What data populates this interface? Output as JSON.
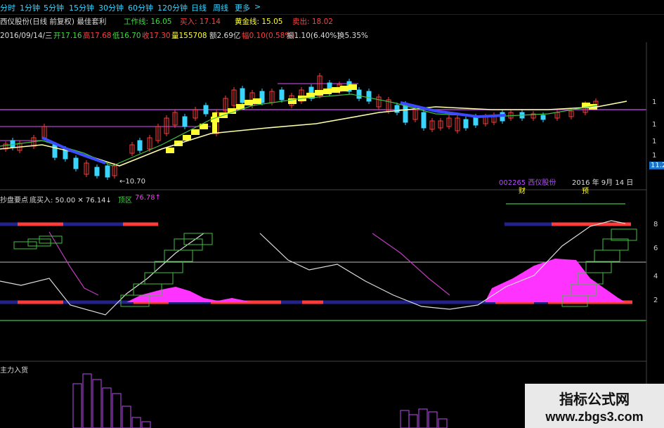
{
  "toolbar": {
    "items": [
      "分时",
      "1分钟",
      "5分钟",
      "15分钟",
      "30分钟",
      "60分钟",
      "120分钟",
      "日线",
      "周线",
      "更多",
      ">"
    ]
  },
  "indicator_row": {
    "name": "西仪股份(日线 前复权) 最佳套利",
    "work_line": "工作线: 16.05",
    "buy": "买入: 17.14",
    "gold_line": "黄金线: 15.05",
    "sell": "卖出: 18.02"
  },
  "quote_row": {
    "date": "2016/09/14/三",
    "open": "开17.16",
    "high": "高17.68",
    "low": "低16.70",
    "close": "收17.30",
    "volume": "量155708",
    "amount": "额2.69亿",
    "change": "幅0.10(0.58%)",
    "amplitude": "振1.10(6.40%)",
    "turnover": "换5.35%"
  },
  "main_chart": {
    "low_annotation": "←10.70",
    "stock_label": "002265 西仪股份",
    "date_label": "2016 年 9月 14 日",
    "marker_1": "财",
    "marker_2": "预",
    "y_labels": [
      "1",
      "1",
      "1",
      "1",
      "11.2"
    ]
  },
  "sub_panel_1": {
    "title": "抄盘要点",
    "buy_ratio": "底买入: 50.00 ✕ 76.14↓",
    "zone": "顶区",
    "zone_value": "76.78↑",
    "y_labels": [
      "8",
      "6",
      "4",
      "2"
    ]
  },
  "sub_panel_2": {
    "title": "主力入货"
  },
  "watermark": {
    "line1": "指标公式网",
    "line2": "www.zbgs3.com"
  },
  "colors": {
    "up": "#ff3b3b",
    "down": "#39d5ff",
    "yellow": "#ffff33",
    "magenta": "#ff33ff",
    "purple": "#9b3fc4",
    "green": "#3fbf3f"
  }
}
